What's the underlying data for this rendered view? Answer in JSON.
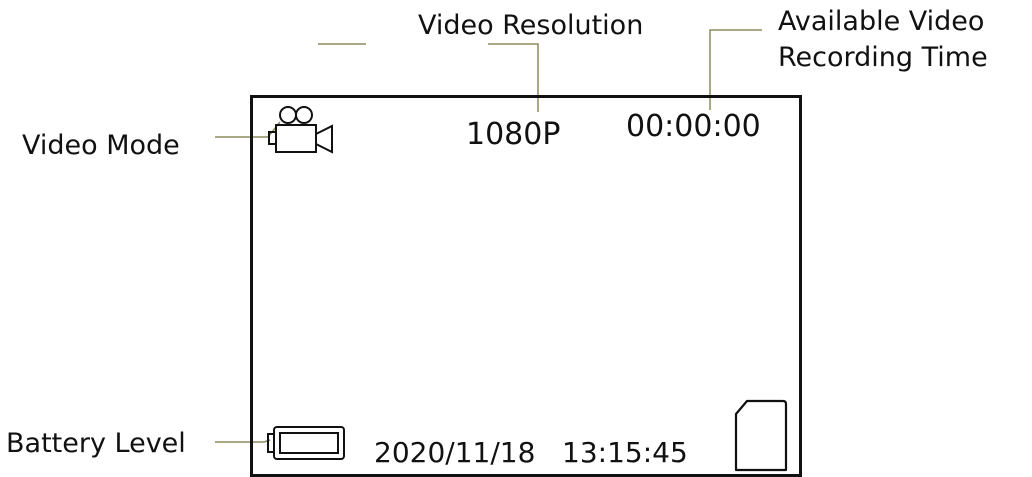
{
  "callouts": {
    "video_resolution": "Video Resolution",
    "available_time_line1": "Available Video",
    "available_time_line2": "Recording Time",
    "video_mode": "Video Mode",
    "battery_level": "Battery Level"
  },
  "screen": {
    "resolution": "1080P",
    "recording_time": "00:00:00",
    "date": "2020/11/18",
    "time": "13:15:45"
  },
  "icons": {
    "mode": "video-camera-icon",
    "battery": "battery-icon",
    "storage": "sd-card-icon"
  },
  "colors": {
    "leader_line": "#8c8a5e",
    "outline": "#111111"
  }
}
